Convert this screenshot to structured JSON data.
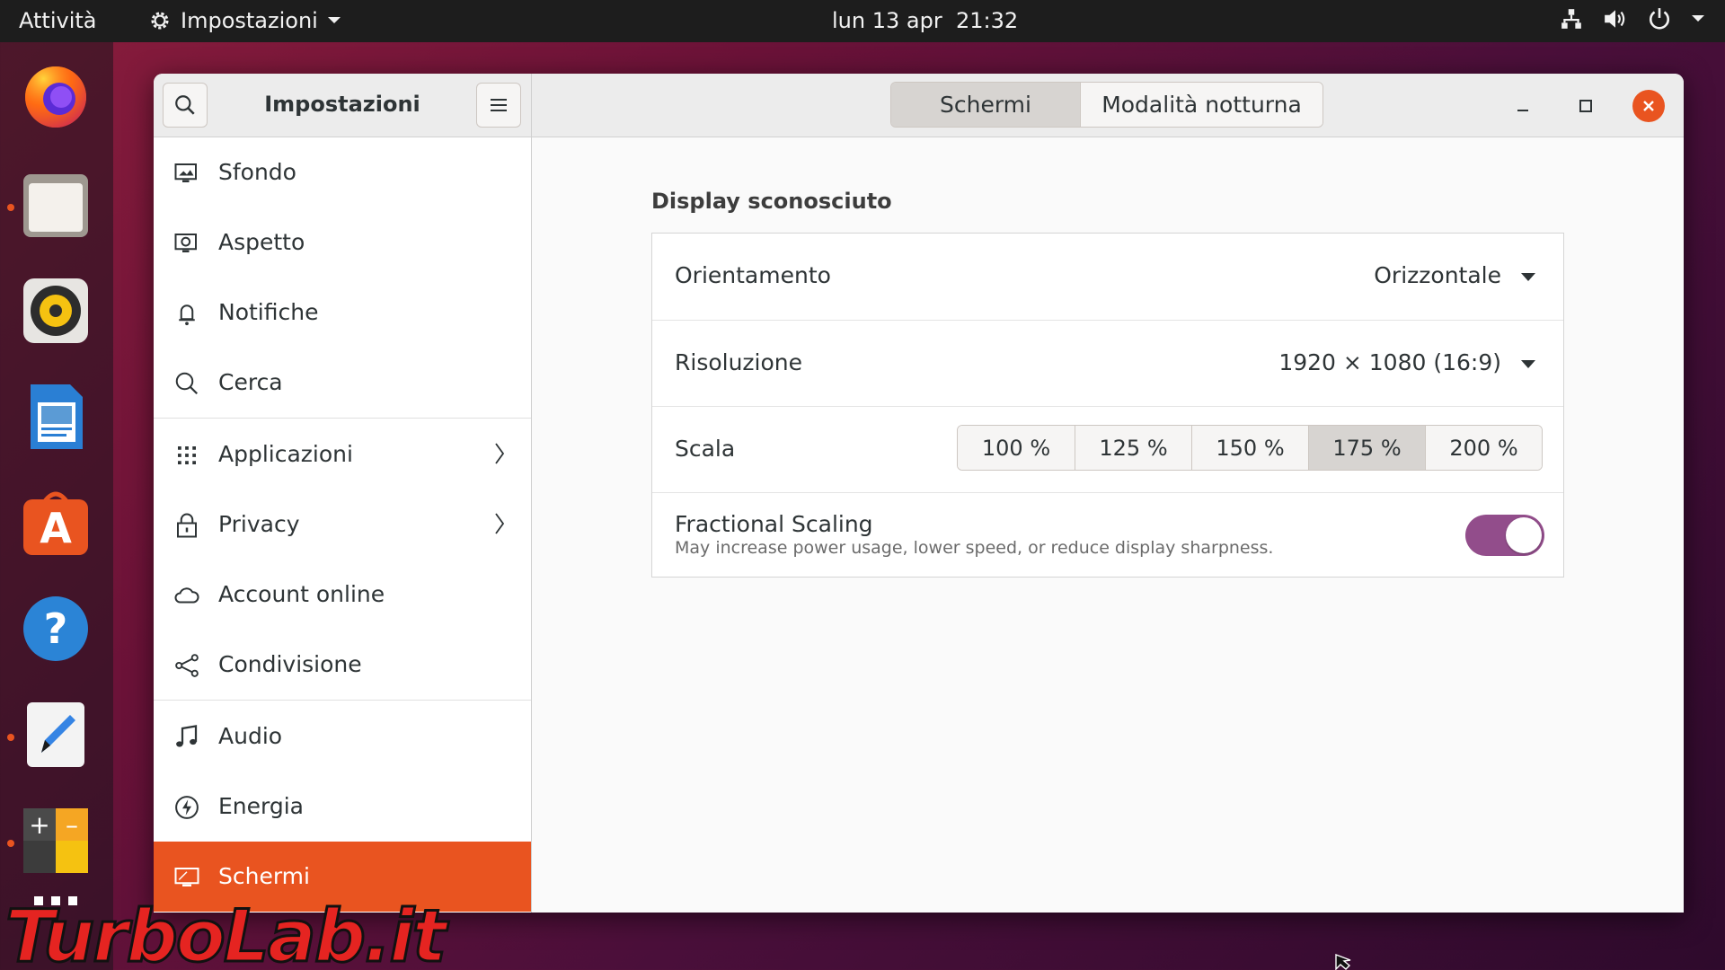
{
  "topbar": {
    "activities": "Attività",
    "app_menu": "Impostazioni",
    "clock": "lun 13 apr  21:32",
    "icons": [
      "network-icon",
      "volume-icon",
      "power-icon",
      "chevron-down-icon"
    ]
  },
  "dock": {
    "apps": [
      "firefox",
      "files",
      "rhythmbox",
      "libreoffice-writer",
      "ubuntu-software",
      "help",
      "text-editor",
      "calculator",
      "show-applications"
    ]
  },
  "window": {
    "sidebar_title": "Impostazioni",
    "stack_switcher": [
      {
        "label": "Schermi",
        "active": true
      },
      {
        "label": "Modalità notturna",
        "active": false
      }
    ]
  },
  "sidebar": {
    "items": [
      {
        "label": "Sfondo",
        "icon": "background-icon"
      },
      {
        "label": "Aspetto",
        "icon": "appearance-icon"
      },
      {
        "label": "Notifiche",
        "icon": "bell-icon"
      },
      {
        "label": "Cerca",
        "icon": "search-icon"
      },
      {
        "label": "Applicazioni",
        "icon": "apps-grid-icon",
        "has_submenu": true
      },
      {
        "label": "Privacy",
        "icon": "lock-icon",
        "has_submenu": true
      },
      {
        "label": "Account online",
        "icon": "cloud-icon"
      },
      {
        "label": "Condivisione",
        "icon": "share-icon"
      },
      {
        "label": "Audio",
        "icon": "music-note-icon"
      },
      {
        "label": "Energia",
        "icon": "power-icon"
      },
      {
        "label": "Schermi",
        "icon": "display-icon",
        "active": true
      }
    ]
  },
  "display": {
    "title": "Display sconosciuto",
    "orientation": {
      "label": "Orientamento",
      "value": "Orizzontale"
    },
    "resolution": {
      "label": "Risoluzione",
      "value": "1920 × 1080 (16:9)"
    },
    "scale": {
      "label": "Scala",
      "options": [
        "100 %",
        "125 %",
        "150 %",
        "175 %",
        "200 %"
      ],
      "selected": "175 %"
    },
    "fractional_scaling": {
      "label": "Fractional Scaling",
      "description": "May increase power usage, lower speed, or reduce display sharpness.",
      "enabled": true
    }
  },
  "watermark": "TurboLab.it",
  "colors": {
    "accent": "#e95420",
    "toggle_on": "#924d8b",
    "topbar": "#1d1d1d"
  }
}
